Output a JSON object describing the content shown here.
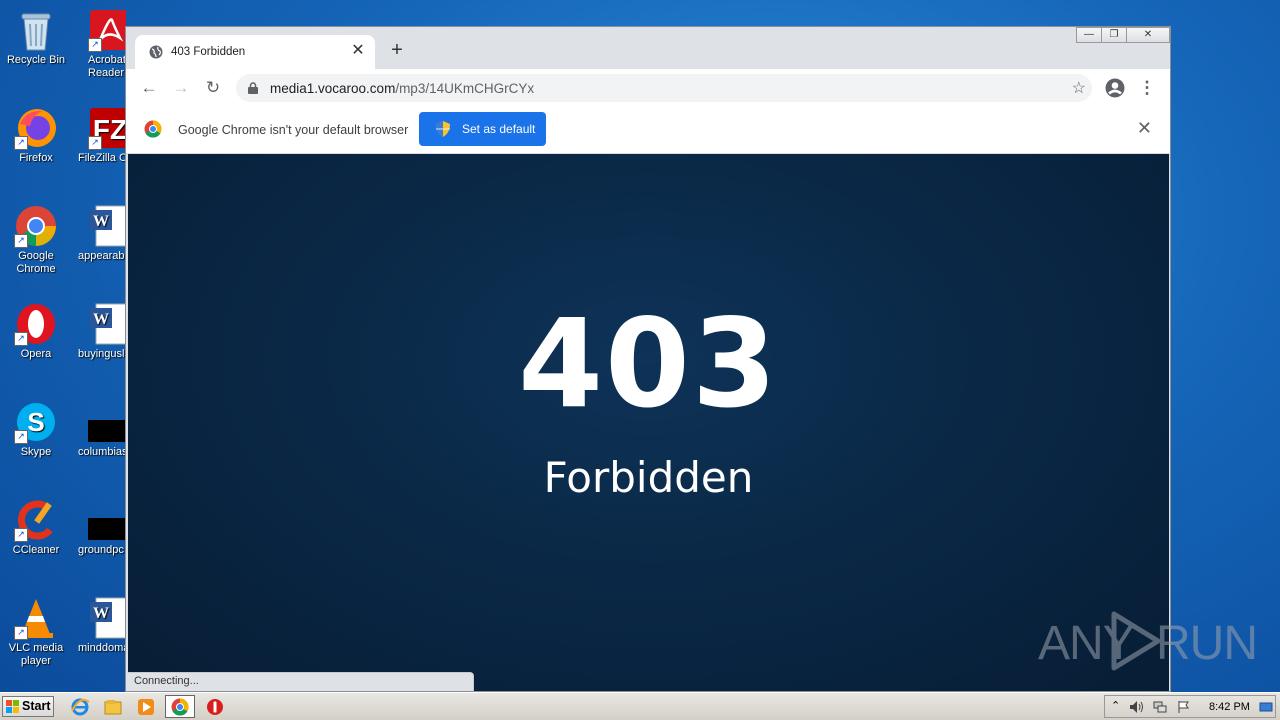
{
  "desktop": {
    "icons": [
      {
        "label": "Recycle Bin"
      },
      {
        "label": "Firefox"
      },
      {
        "label": "Google Chrome"
      },
      {
        "label": "Opera"
      },
      {
        "label": "Skype"
      },
      {
        "label": "CCleaner"
      },
      {
        "label": "VLC media player"
      },
      {
        "label": "Acrobat Reader"
      },
      {
        "label": "FileZilla C"
      },
      {
        "label": "appearab"
      },
      {
        "label": "buyingusl"
      },
      {
        "label": "columbias"
      },
      {
        "label": "groundpc"
      },
      {
        "label": "minddoma"
      }
    ]
  },
  "browser": {
    "tab": {
      "title": "403 Forbidden",
      "close": "✕"
    },
    "new_tab": "+",
    "window_controls": {
      "minimize": "—",
      "restore": "❐",
      "close": "✕"
    },
    "nav": {
      "back": "←",
      "forward": "→",
      "reload": "↻"
    },
    "address": {
      "host": "media1.vocaroo.com",
      "path": "/mp3/14UKmCHGrCYx",
      "star": "☆"
    },
    "menu": "⋮",
    "infobar": {
      "message": "Google Chrome isn't your default browser",
      "button": "Set as default",
      "close": "✕"
    },
    "page": {
      "code": "403",
      "text": "Forbidden"
    },
    "status": "Connecting..."
  },
  "watermark": {
    "left": "ANY",
    "right": "RUN"
  },
  "taskbar": {
    "start": "Start",
    "clock": "8:42 PM",
    "pinned": [
      "ie-icon",
      "explorer-icon",
      "media-player-icon",
      "chrome-icon",
      "stop-icon"
    ]
  }
}
